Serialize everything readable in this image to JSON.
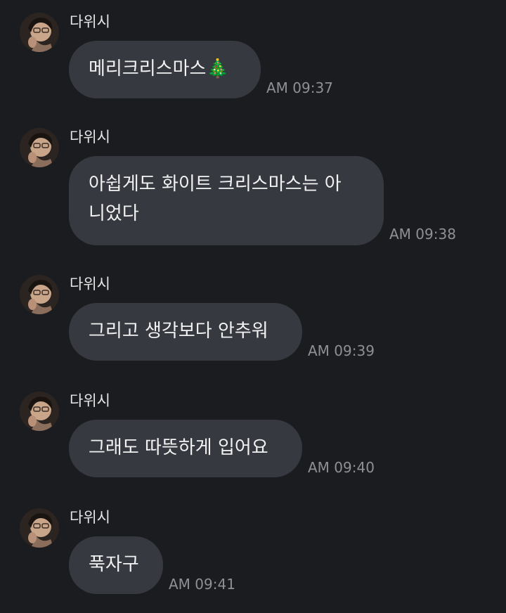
{
  "colors": {
    "background": "#1b1c20",
    "bubble": "#373940",
    "text": "#f2f2f2",
    "time": "#8e9096"
  },
  "messages": [
    {
      "sender": "다위시",
      "text": "메리크리스마스🎄",
      "time": "AM 09:37"
    },
    {
      "sender": "다위시",
      "text": "아쉽게도 화이트 크리스마스는 아니었다",
      "line1": "아쉽게도 화이트 크리스마스는 아",
      "line2": "니었다",
      "time": "AM 09:38"
    },
    {
      "sender": "다위시",
      "text": "그리고 생각보다 안추워",
      "time": "AM 09:39"
    },
    {
      "sender": "다위시",
      "text": "그래도 따뜻하게 입어요",
      "time": "AM 09:40"
    },
    {
      "sender": "다위시",
      "text": "푹자구",
      "time": "AM 09:41"
    }
  ],
  "icons": {
    "avatar": "profile-photo-icon"
  }
}
